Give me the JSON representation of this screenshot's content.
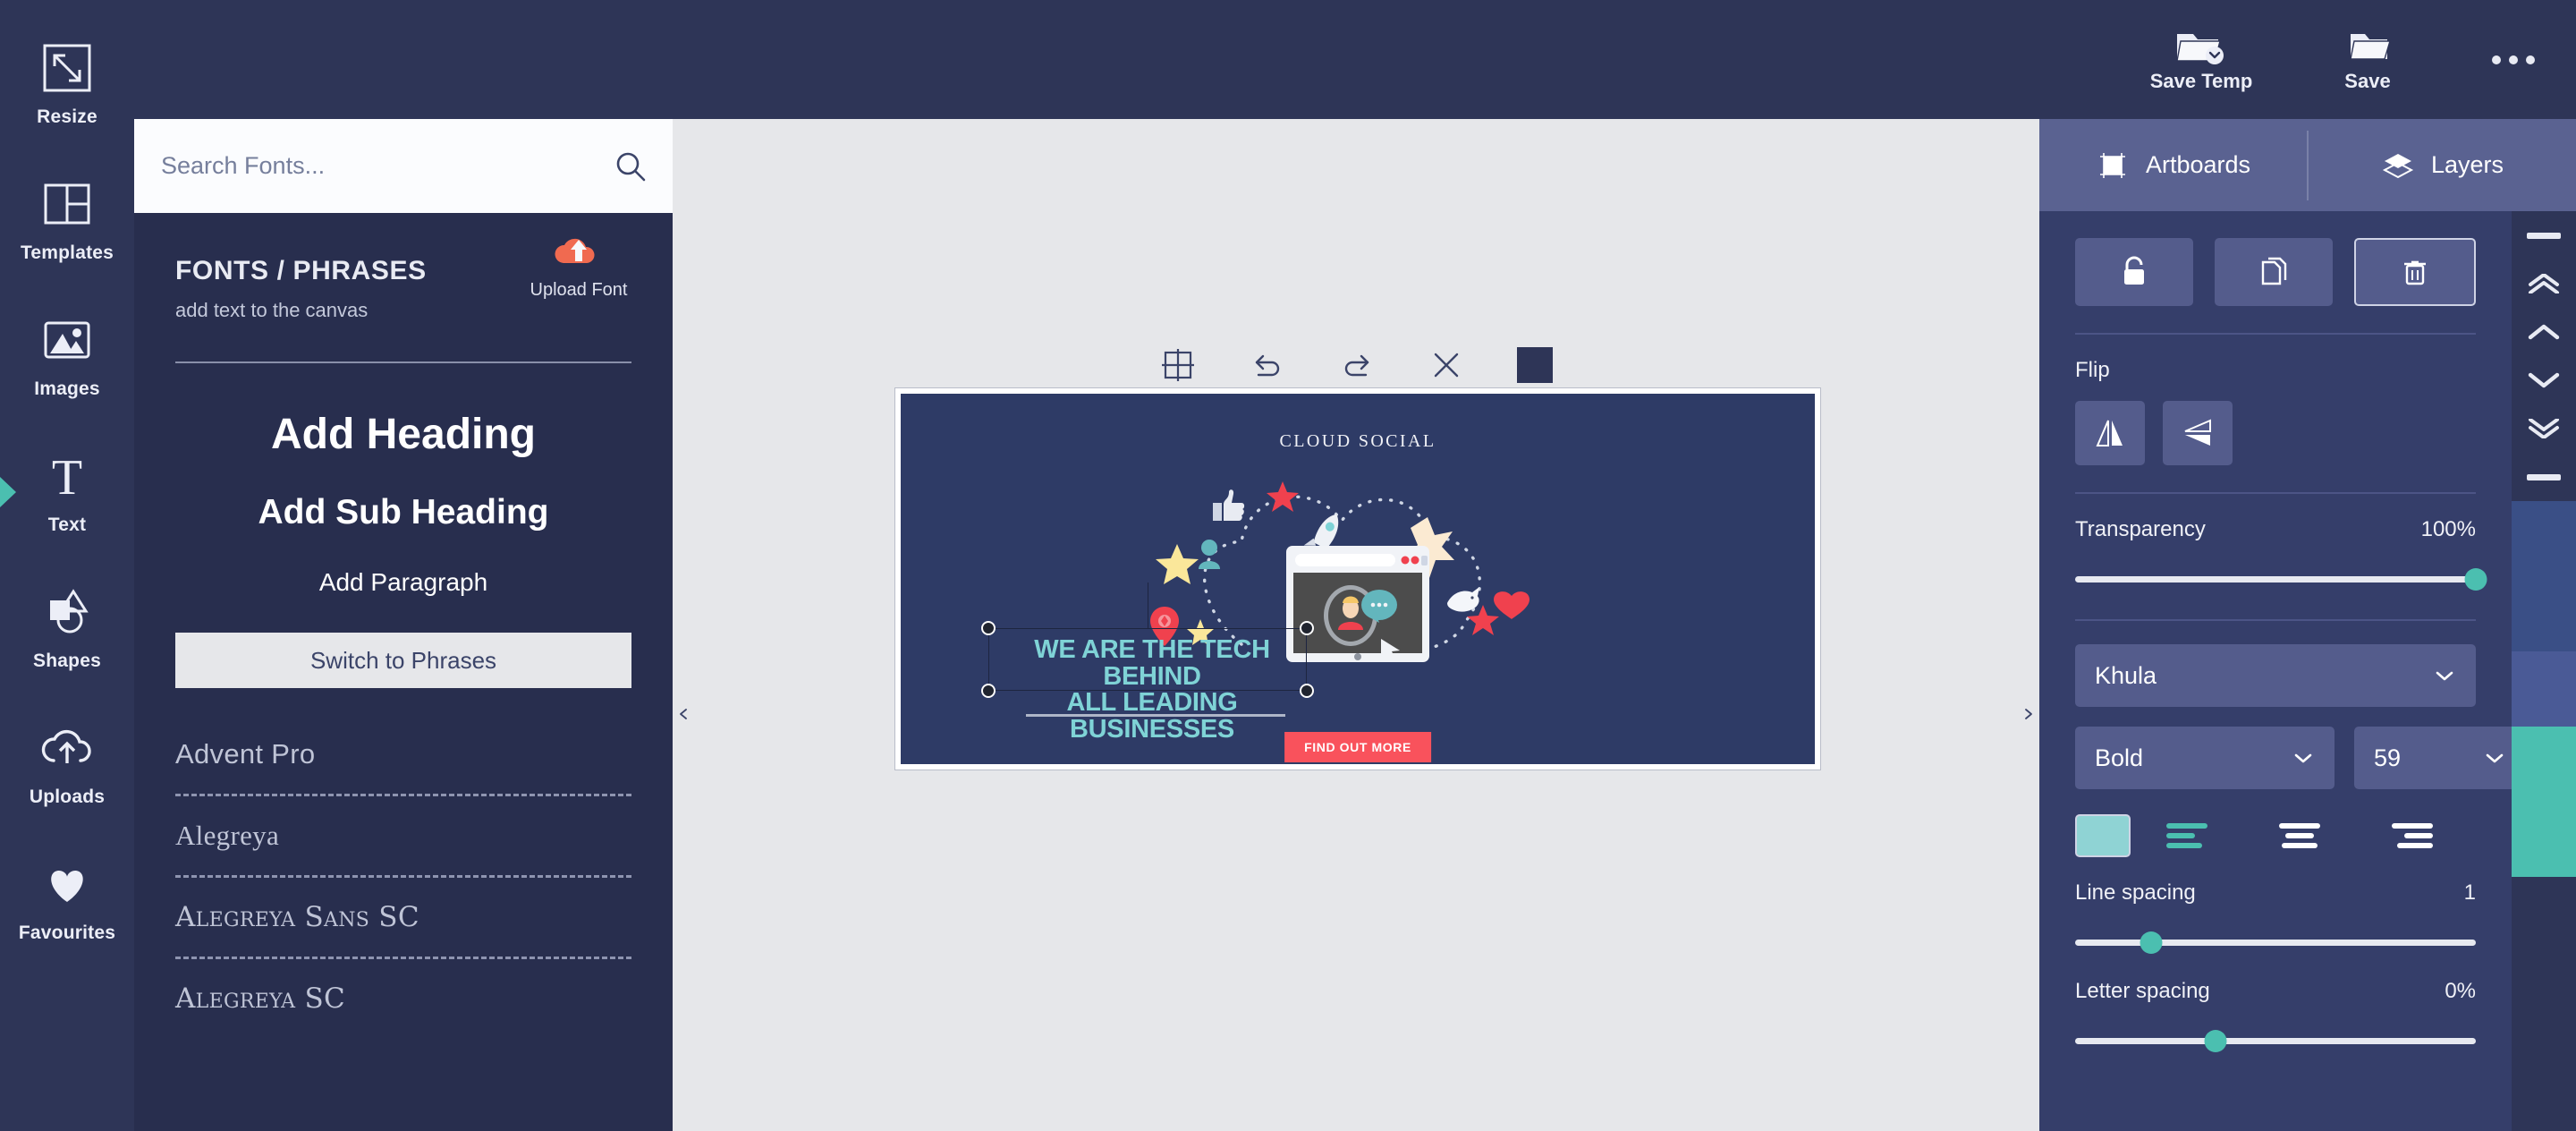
{
  "app": {
    "accent_teal": "#4bbfb0",
    "panel_navy": "#2e3557",
    "rail_navy": "#2e3557",
    "canvas_gray": "#e6e7ea"
  },
  "left_rail": {
    "items": [
      {
        "label": "Resize",
        "icon": "resize-icon",
        "active": false
      },
      {
        "label": "Templates",
        "icon": "templates-icon",
        "active": false
      },
      {
        "label": "Images",
        "icon": "images-icon",
        "active": false
      },
      {
        "label": "Text",
        "icon": "text-icon",
        "active": true
      },
      {
        "label": "Shapes",
        "icon": "shapes-icon",
        "active": false
      },
      {
        "label": "Uploads",
        "icon": "uploads-icon",
        "active": false
      },
      {
        "label": "Favourites",
        "icon": "heart-icon",
        "active": false
      }
    ]
  },
  "topbar": {
    "buttons": [
      {
        "label": "Save Temp",
        "icon": "save-template-icon"
      },
      {
        "label": "Save",
        "icon": "save-folder-icon"
      }
    ],
    "more_icon": "more-options-icon"
  },
  "fonts_panel": {
    "search": {
      "placeholder": "Search Fonts...",
      "value": "",
      "icon": "search-icon"
    },
    "title": "FONTS / PHRASES",
    "subtitle": "add text to the canvas",
    "upload": {
      "label": "Upload Font",
      "icon": "upload-cloud-icon"
    },
    "add_buttons": {
      "heading": "Add Heading",
      "subheading": "Add Sub Heading",
      "paragraph": "Add Paragraph"
    },
    "switch_label": "Switch to Phrases",
    "font_list": [
      {
        "name": "Advent Pro",
        "style": "sans"
      },
      {
        "name": "Alegreya",
        "style": "serif"
      },
      {
        "name": "Alegreya Sans SC",
        "style": "smallcaps"
      },
      {
        "name": "Alegreya SC",
        "style": "smallcaps"
      }
    ]
  },
  "canvas": {
    "toolbar": [
      {
        "icon": "grid-icon",
        "name": "grid"
      },
      {
        "icon": "undo-icon",
        "name": "undo"
      },
      {
        "icon": "redo-icon",
        "name": "redo"
      },
      {
        "icon": "close-icon",
        "name": "close"
      }
    ],
    "swatch_color": "#2e3557",
    "collapse_left_icon": "chevron-left-icon",
    "collapse_right_icon": "chevron-right-icon",
    "design": {
      "background": "#2e3b66",
      "brand": "CLOUD SOCIAL",
      "headline_line1": "WE ARE THE TECH BEHIND",
      "headline_line2": "ALL LEADING BUSINESSES",
      "headline_color": "#7fd3d6",
      "cta_label": "FIND OUT MORE",
      "cta_color": "#f9525c"
    }
  },
  "right_panel": {
    "tabs": [
      {
        "label": "Artboards",
        "icon": "artboard-icon",
        "active": false
      },
      {
        "label": "Layers",
        "icon": "layers-icon",
        "active": false
      }
    ],
    "actions": [
      {
        "name": "lock",
        "icon": "lock-icon",
        "outlined": false
      },
      {
        "name": "duplicate",
        "icon": "duplicate-icon",
        "outlined": false
      },
      {
        "name": "delete",
        "icon": "trash-icon",
        "outlined": true
      }
    ],
    "flip": {
      "label": "Flip",
      "buttons": [
        {
          "name": "flip-horizontal",
          "icon": "flip-horizontal-icon"
        },
        {
          "name": "flip-vertical",
          "icon": "flip-vertical-icon"
        }
      ]
    },
    "transparency": {
      "label": "Transparency",
      "value": "100%",
      "percent": 100
    },
    "font_family": {
      "value": "Khula",
      "icon": "chevron-down-icon"
    },
    "font_weight": {
      "value": "Bold",
      "icon": "chevron-down-icon"
    },
    "font_size": {
      "value": "59",
      "icon": "chevron-down-icon"
    },
    "text_color": {
      "swatch": "#8fd3d4"
    },
    "alignment": [
      {
        "name": "align-left",
        "icon": "align-left-icon",
        "active": true
      },
      {
        "name": "align-center",
        "icon": "align-center-icon",
        "active": false
      },
      {
        "name": "align-right",
        "icon": "align-right-icon",
        "active": false
      }
    ],
    "line_spacing": {
      "label": "Line spacing",
      "value": "1",
      "percent": 19
    },
    "letter_spacing": {
      "label": "Letter spacing",
      "value": "0%",
      "percent": 35
    }
  },
  "scroll_strip": {
    "buttons": [
      {
        "name": "move-to-top",
        "icon": "bar-top-icon"
      },
      {
        "name": "move-up-all",
        "icon": "double-chevron-up-icon"
      },
      {
        "name": "move-up",
        "icon": "chevron-up-icon"
      },
      {
        "name": "move-down",
        "icon": "chevron-down-icon"
      },
      {
        "name": "move-down-all",
        "icon": "double-chevron-down-icon"
      },
      {
        "name": "move-to-bottom",
        "icon": "bar-bottom-icon"
      }
    ],
    "swatches": [
      "#3a4f86",
      "#3a4f86",
      "#4a5a96",
      "#4bbfb0",
      "#4bbfb0"
    ]
  }
}
